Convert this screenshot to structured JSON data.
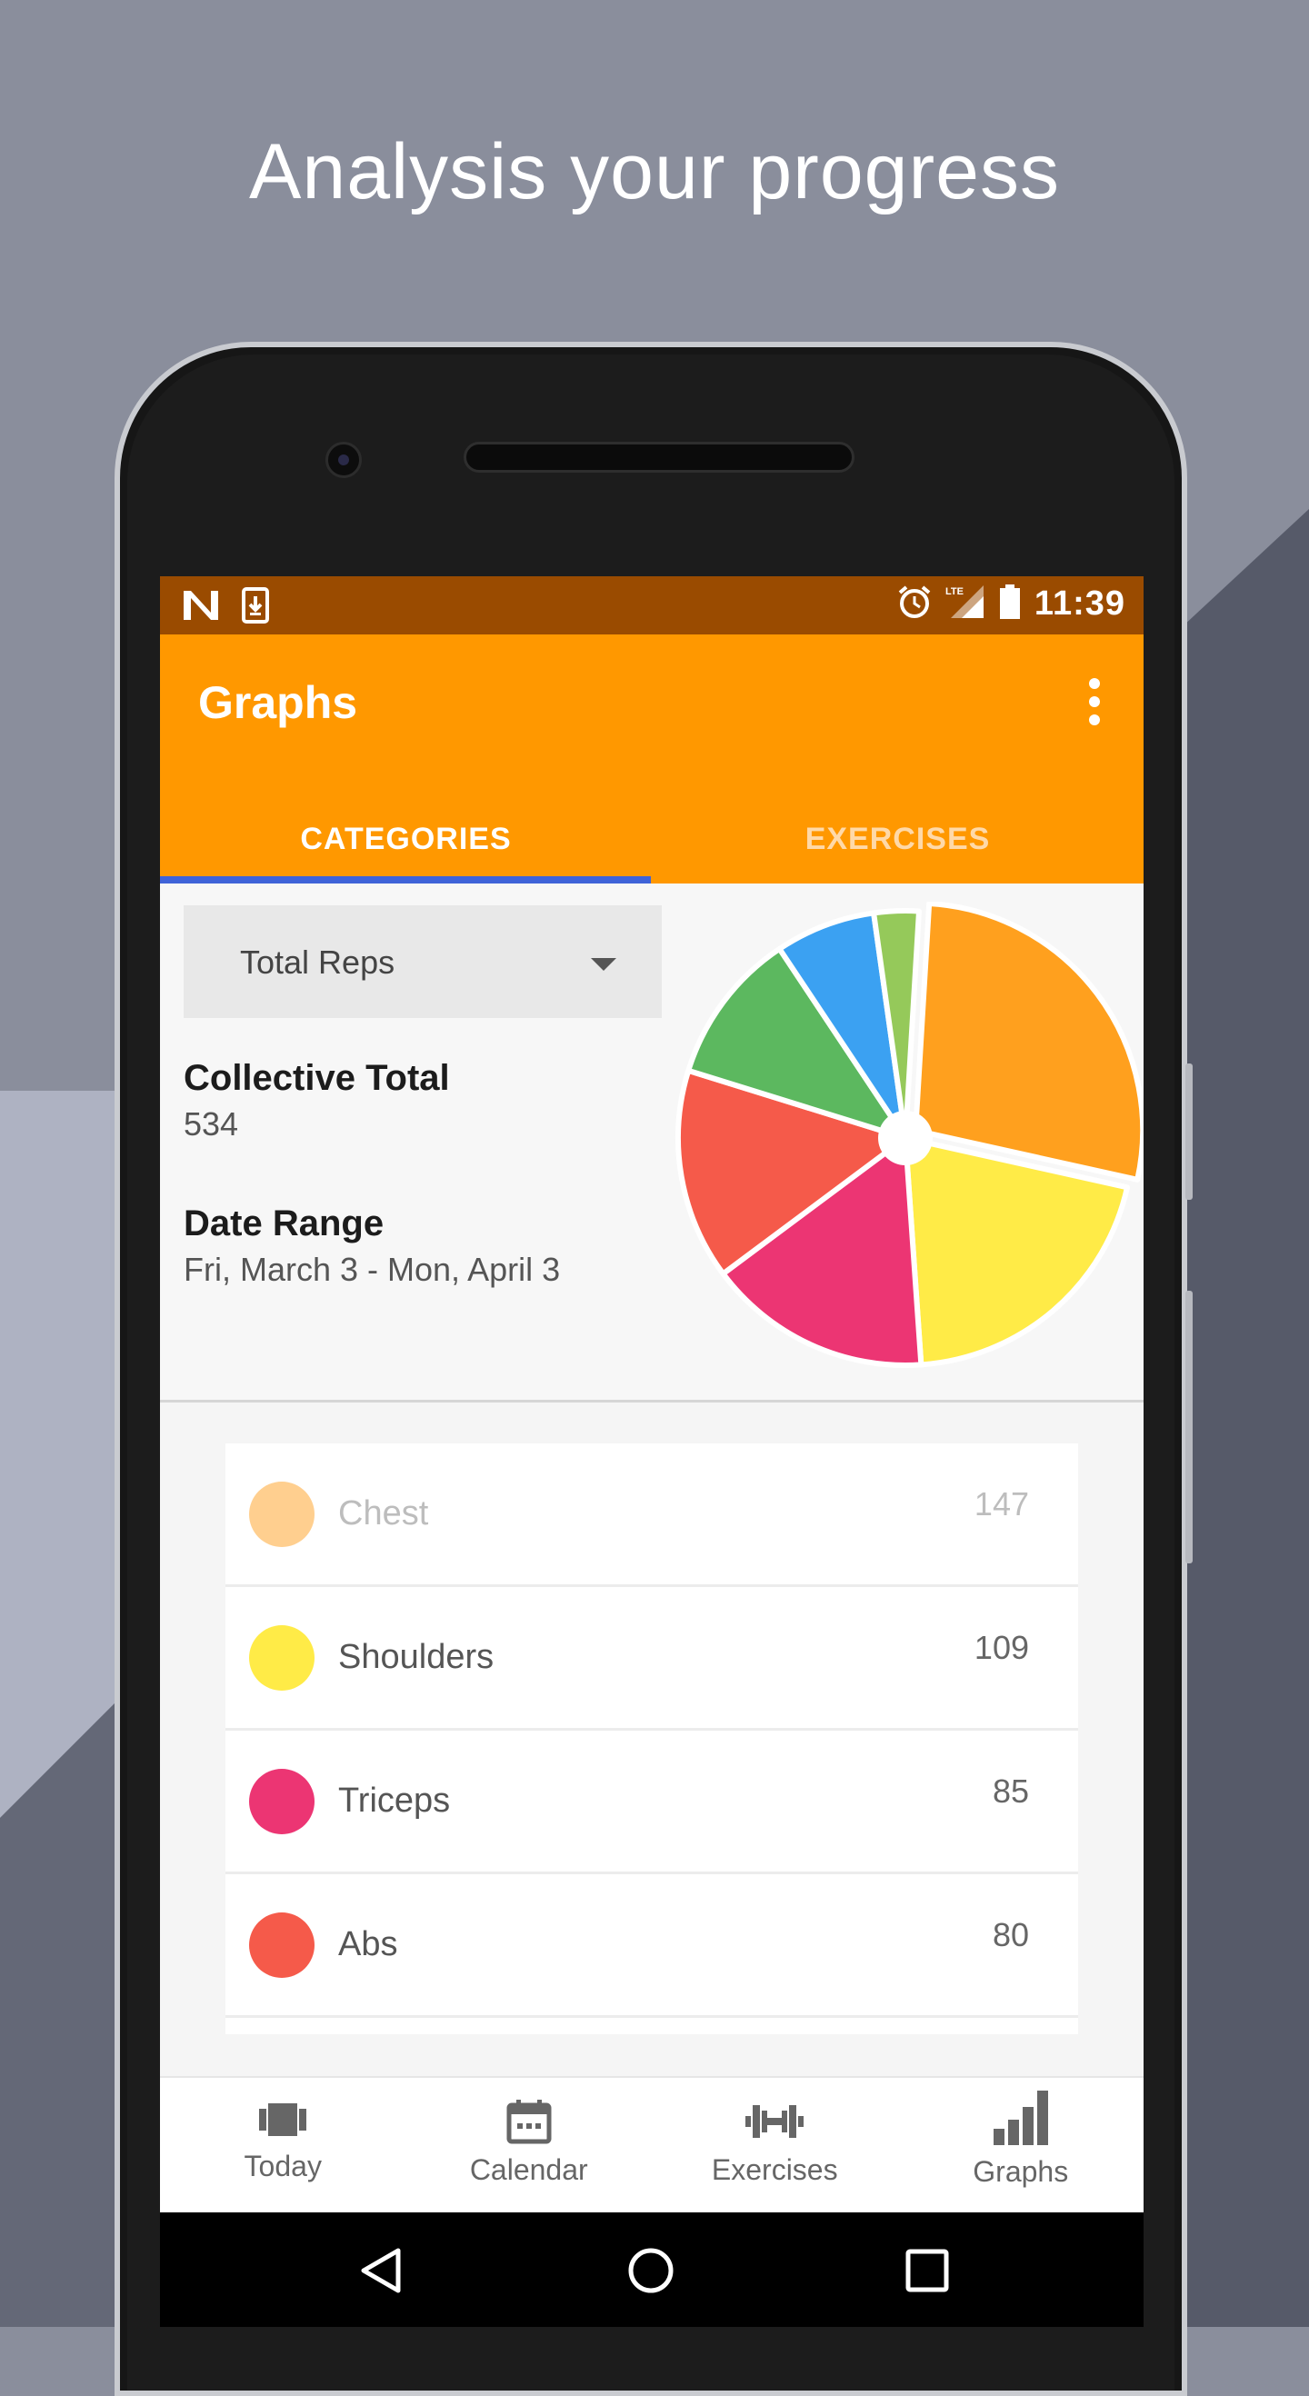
{
  "headline": "Analysis your progress",
  "status_bar": {
    "time": "11:39",
    "icons": [
      "n-logo-icon",
      "download-icon",
      "alarm-icon",
      "lte-signal-icon",
      "battery-icon"
    ],
    "lte_label": "LTE"
  },
  "app_bar": {
    "title": "Graphs",
    "overflow_icon": "more-vert-icon"
  },
  "tabs": [
    {
      "label": "CATEGORIES",
      "selected": true
    },
    {
      "label": "EXERCISES",
      "selected": false
    }
  ],
  "summary": {
    "metric_select": {
      "value": "Total Reps"
    },
    "collective_total_label": "Collective Total",
    "collective_total_value": "534",
    "date_range_label": "Date Range",
    "date_range_value": "Fri, March 3 - Mon, April 3"
  },
  "chart_data": {
    "type": "pie",
    "slices": [
      {
        "label": "Chest",
        "value": 147,
        "color": "#ffa01e"
      },
      {
        "label": "Shoulders",
        "value": 109,
        "color": "#ffeb47"
      },
      {
        "label": "Triceps",
        "value": 85,
        "color": "#ec3573"
      },
      {
        "label": "Abs",
        "value": 80,
        "color": "#f55a4a"
      },
      {
        "label": "",
        "value": 58,
        "color": "#5cb85f"
      },
      {
        "label": "",
        "value": 38,
        "color": "#3ba1f2"
      },
      {
        "label": "",
        "value": 17,
        "color": "#95c95a"
      }
    ]
  },
  "category_list": [
    {
      "name": "Chest",
      "count": "147",
      "color": "#ffcf8f",
      "faded": true
    },
    {
      "name": "Shoulders",
      "count": "109",
      "color": "#ffeb47",
      "faded": false
    },
    {
      "name": "Triceps",
      "count": "85",
      "color": "#ec3573",
      "faded": false
    },
    {
      "name": "Abs",
      "count": "80",
      "color": "#f55a4a",
      "faded": false
    }
  ],
  "bottom_nav": [
    {
      "label": "Today",
      "icon": "today-icon"
    },
    {
      "label": "Calendar",
      "icon": "calendar-icon"
    },
    {
      "label": "Exercises",
      "icon": "dumbbell-icon"
    },
    {
      "label": "Graphs",
      "icon": "bar-chart-icon"
    }
  ],
  "colors": {
    "status_bar": "#9a4b00",
    "primary": "#ff9800",
    "tab_indicator": "#3f63d8"
  }
}
